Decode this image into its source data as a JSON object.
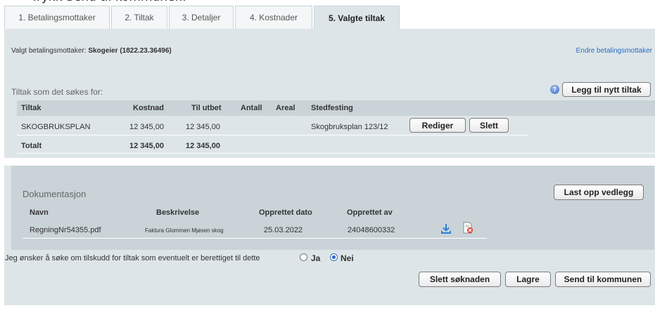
{
  "page": {
    "clipped_heading": "Trykk Send til kommunen."
  },
  "tabs": [
    {
      "label": "1. Betalingsmottaker"
    },
    {
      "label": "2. Tiltak"
    },
    {
      "label": "3. Detaljer"
    },
    {
      "label": "4. Kostnader"
    },
    {
      "label": "5. Valgte tiltak"
    }
  ],
  "recipient": {
    "prefix": "Valgt betalingsmottaker:",
    "name": "Skogeier (1822.23.36496)",
    "change_link": "Endre betalingsmottaker"
  },
  "measures": {
    "section_title": "Tiltak som det søkes for:",
    "help_icon": "?",
    "add_button": "Legg til nytt tiltak",
    "headers": {
      "tiltak": "Tiltak",
      "kostnad": "Kostnad",
      "til_utbet": "Til utbet",
      "antall": "Antall",
      "areal": "Areal",
      "stedfesting": "Stedfesting"
    },
    "rows": [
      {
        "tiltak": "SKOGBRUKSPLAN",
        "kostnad": "12 345,00",
        "til_utbet": "12 345,00",
        "antall": "",
        "areal": "",
        "stedfesting": "Skogbruksplan 123/12",
        "edit_label": "Rediger",
        "delete_label": "Slett"
      }
    ],
    "total": {
      "label": "Totalt",
      "kostnad": "12 345,00",
      "til_utbet": "12 345,00"
    }
  },
  "documentation": {
    "title": "Dokumentasjon",
    "upload_button": "Last opp vedlegg",
    "headers": {
      "navn": "Navn",
      "beskrivelse": "Beskrivelse",
      "opprettet_dato": "Opprettet dato",
      "opprettet_av": "Opprettet av"
    },
    "rows": [
      {
        "navn": "RegningNr54355.pdf",
        "beskrivelse": "Faktura Glommen Mjøsen skog",
        "opprettet_dato": "25.03.2022",
        "opprettet_av": "24048600332",
        "download_icon": "download-icon",
        "delete_icon": "delete-file-icon"
      }
    ]
  },
  "subsidy_question": {
    "text": "Jeg ønsker å søke om tilskudd for tiltak som eventuelt er berettiget til dette",
    "options": [
      {
        "label": "Ja",
        "checked": false
      },
      {
        "label": "Nei",
        "checked": true
      }
    ]
  },
  "actions": {
    "delete_application": "Slett søknaden",
    "save": "Lagre",
    "send": "Send til kommunen"
  },
  "colors": {
    "panel": "#dde5e8",
    "table_header": "#c9d3d8",
    "link": "#2a6bc2",
    "radio_selected": "#2f63c0"
  }
}
